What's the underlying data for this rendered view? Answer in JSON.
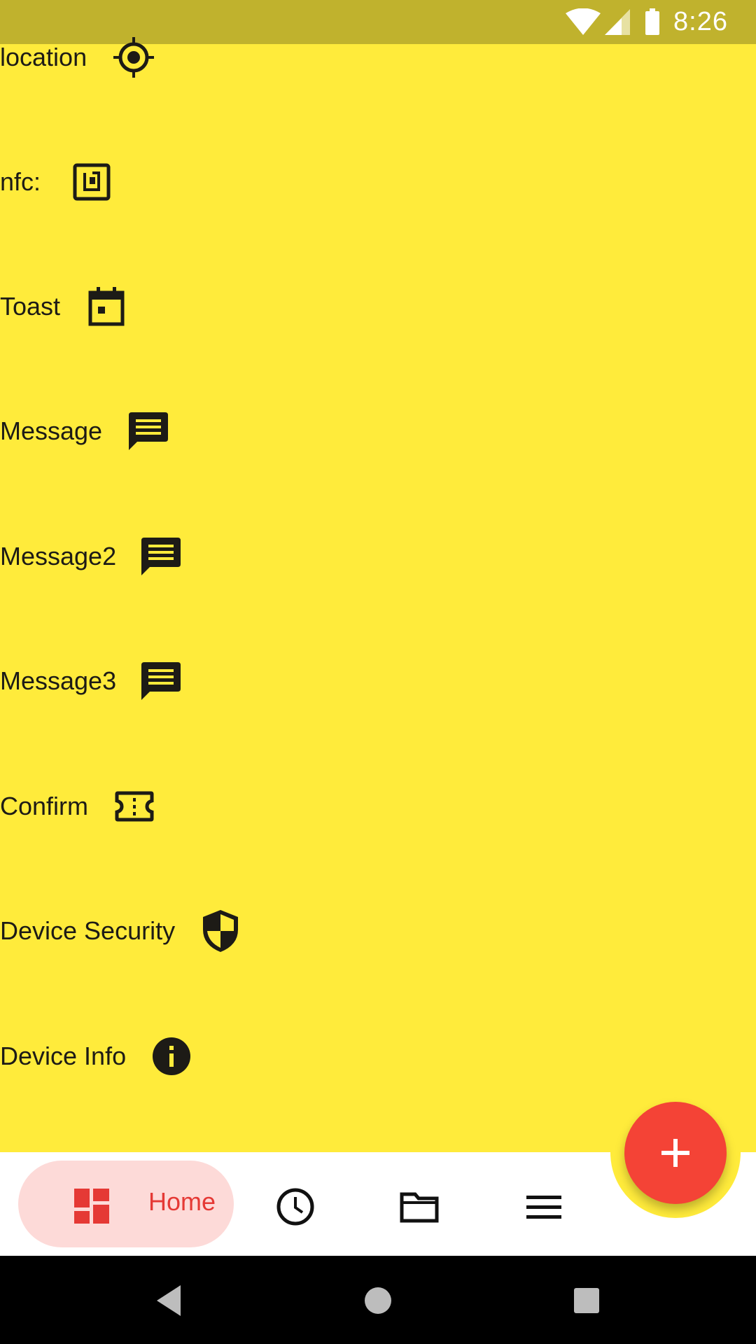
{
  "status_bar": {
    "time": "8:26",
    "icons": [
      "wifi-icon",
      "signal-icon",
      "battery-icon"
    ]
  },
  "list_items": [
    {
      "label": "location",
      "icon": "my-location-icon"
    },
    {
      "label": "nfc:",
      "icon": "nfc-icon"
    },
    {
      "label": "Toast",
      "icon": "calendar-icon"
    },
    {
      "label": "Message",
      "icon": "message-icon"
    },
    {
      "label": "Message2",
      "icon": "message-icon"
    },
    {
      "label": "Message3",
      "icon": "message-icon"
    },
    {
      "label": "Confirm",
      "icon": "ticket-icon"
    },
    {
      "label": "Device Security",
      "icon": "shield-icon"
    },
    {
      "label": "Device Info",
      "icon": "info-icon"
    }
  ],
  "bottom_nav": {
    "home_label": "Home",
    "items": [
      "dashboard-icon",
      "history-icon",
      "folder-icon",
      "menu-icon"
    ]
  },
  "fab": {
    "icon": "add-icon"
  },
  "colors": {
    "background": "#ffeb3b",
    "status_bar": "#c0b22d",
    "accent": "#f44336",
    "home_pill": "#fddad8"
  }
}
